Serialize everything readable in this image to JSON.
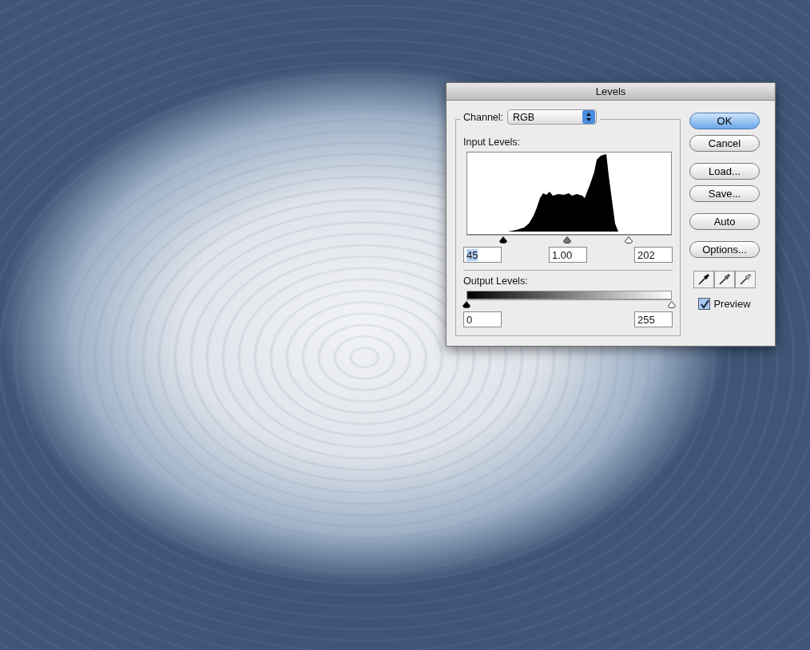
{
  "dialog": {
    "title": "Levels",
    "channel": {
      "label": "Channel:",
      "value": "RGB"
    },
    "input_levels": {
      "label": "Input Levels:",
      "thumbs": [
        {
          "kind": "shadow",
          "level": 0.18
        },
        {
          "kind": "midtone",
          "level": 0.49
        },
        {
          "kind": "highlight",
          "level": 0.79
        }
      ],
      "fields": [
        {
          "value": "45",
          "text_selected": true
        },
        {
          "value": "1.00",
          "text_selected": false
        },
        {
          "value": "202",
          "text_selected": false
        }
      ]
    },
    "output_levels": {
      "label": "Output Levels:",
      "thumbs": [
        {
          "kind": "shadow",
          "level": 0
        },
        {
          "kind": "highlight",
          "level": 1
        }
      ],
      "fields": [
        {
          "value": "0",
          "text_selected": false
        },
        {
          "value": "255",
          "text_selected": false
        }
      ]
    },
    "buttons": [
      {
        "label": "OK",
        "default": true
      },
      {
        "label": "Cancel",
        "default": false
      },
      {
        "label": "Load...",
        "default": false
      },
      {
        "label": "Save...",
        "default": false
      },
      {
        "label": "Auto",
        "default": false
      },
      {
        "label": "Options...",
        "default": false
      }
    ],
    "preview": {
      "label": "Preview",
      "checked": true
    }
  }
}
